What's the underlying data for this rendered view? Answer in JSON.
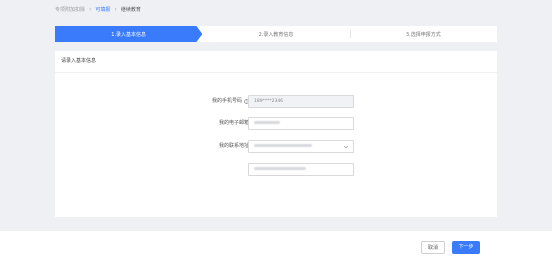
{
  "breadcrumb": {
    "items": [
      "专项附加扣除",
      "可填报",
      "继续教育"
    ]
  },
  "steps": [
    {
      "label": "1.录入基本信息",
      "active": true
    },
    {
      "label": "2.录入教育信息",
      "active": false
    },
    {
      "label": "3.选择申报方式",
      "active": false
    }
  ],
  "card": {
    "title": "请录入基本信息"
  },
  "form": {
    "phone": {
      "label": "我的手机号码",
      "value": "189****2346"
    },
    "email": {
      "label": "我的电子邮箱"
    },
    "address": {
      "label": "我的联系地址"
    }
  },
  "footer": {
    "cancel_label": "取消",
    "next_label": "下一步"
  },
  "colors": {
    "accent": "#3a7bfc",
    "background": "#eef0f4"
  }
}
